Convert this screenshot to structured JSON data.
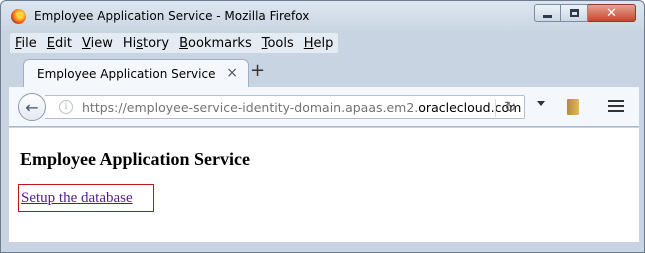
{
  "window": {
    "title": "Employee Application Service - Mozilla Firefox"
  },
  "menu": {
    "items": [
      {
        "underline": "F",
        "rest": "ile"
      },
      {
        "underline": "E",
        "rest": "dit"
      },
      {
        "underline": "V",
        "rest": "iew"
      },
      {
        "pre": "Hi",
        "underline": "s",
        "rest": "tory"
      },
      {
        "underline": "B",
        "rest": "ookmarks"
      },
      {
        "underline": "T",
        "rest": "ools"
      },
      {
        "underline": "H",
        "rest": "elp"
      }
    ]
  },
  "tab": {
    "label": "Employee Application Service",
    "close_glyph": "×",
    "new_tab_glyph": "+"
  },
  "nav": {
    "url_prefix": "https://employee-service-identity-domain.apaas.em2.",
    "url_domain": "oraclecloud.com"
  },
  "page": {
    "heading": "Employee Application Service",
    "link_text": "Setup the database",
    "link_color": "#551a8b",
    "highlight_color": "#c0131a"
  },
  "icons": {
    "back": "arrow-left-icon",
    "info": "info-icon",
    "reload": "reload-icon",
    "bookmark": "bookmark-icon",
    "menu": "hamburger-menu-icon"
  }
}
